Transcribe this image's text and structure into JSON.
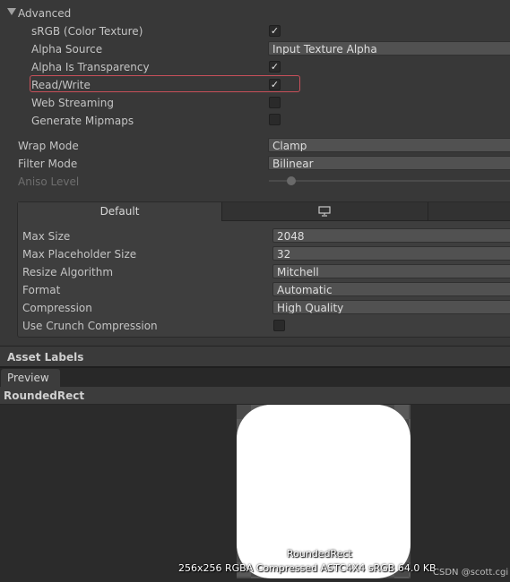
{
  "advanced": {
    "title": "Advanced",
    "srgb_label": "sRGB (Color Texture)",
    "srgb_checked": true,
    "alpha_source_label": "Alpha Source",
    "alpha_source_value": "Input Texture Alpha",
    "alpha_transparency_label": "Alpha Is Transparency",
    "alpha_transparency_checked": true,
    "read_write_label": "Read/Write",
    "read_write_checked": true,
    "web_streaming_label": "Web Streaming",
    "web_streaming_checked": false,
    "generate_mipmaps_label": "Generate Mipmaps",
    "generate_mipmaps_checked": false
  },
  "wrap": {
    "label": "Wrap Mode",
    "value": "Clamp"
  },
  "filter": {
    "label": "Filter Mode",
    "value": "Bilinear"
  },
  "aniso": {
    "label": "Aniso Level",
    "slider_fraction": 0.15
  },
  "platform": {
    "tab_default": "Default",
    "tab_desktop_icon": "monitor-icon",
    "max_size_label": "Max Size",
    "max_size_value": "2048",
    "max_placeholder_label": "Max Placeholder Size",
    "max_placeholder_value": "32",
    "resize_label": "Resize Algorithm",
    "resize_value": "Mitchell",
    "format_label": "Format",
    "format_value": "Automatic",
    "compression_label": "Compression",
    "compression_value": "High Quality",
    "crunch_label": "Use Crunch Compression",
    "crunch_checked": false
  },
  "asset_labels": {
    "title": "Asset Labels"
  },
  "preview": {
    "tab": "Preview",
    "asset_name": "RoundedRect",
    "overlay_name": "RoundedRect",
    "overlay_info": "256x256  RGBA Compressed ASTC4X4 sRGB   64.0 KB"
  },
  "watermark": "CSDN @scott.cgi",
  "colors": {
    "highlight_border": "#c8505a",
    "background": "#383838",
    "preview_bg": "#2b2b2b"
  }
}
